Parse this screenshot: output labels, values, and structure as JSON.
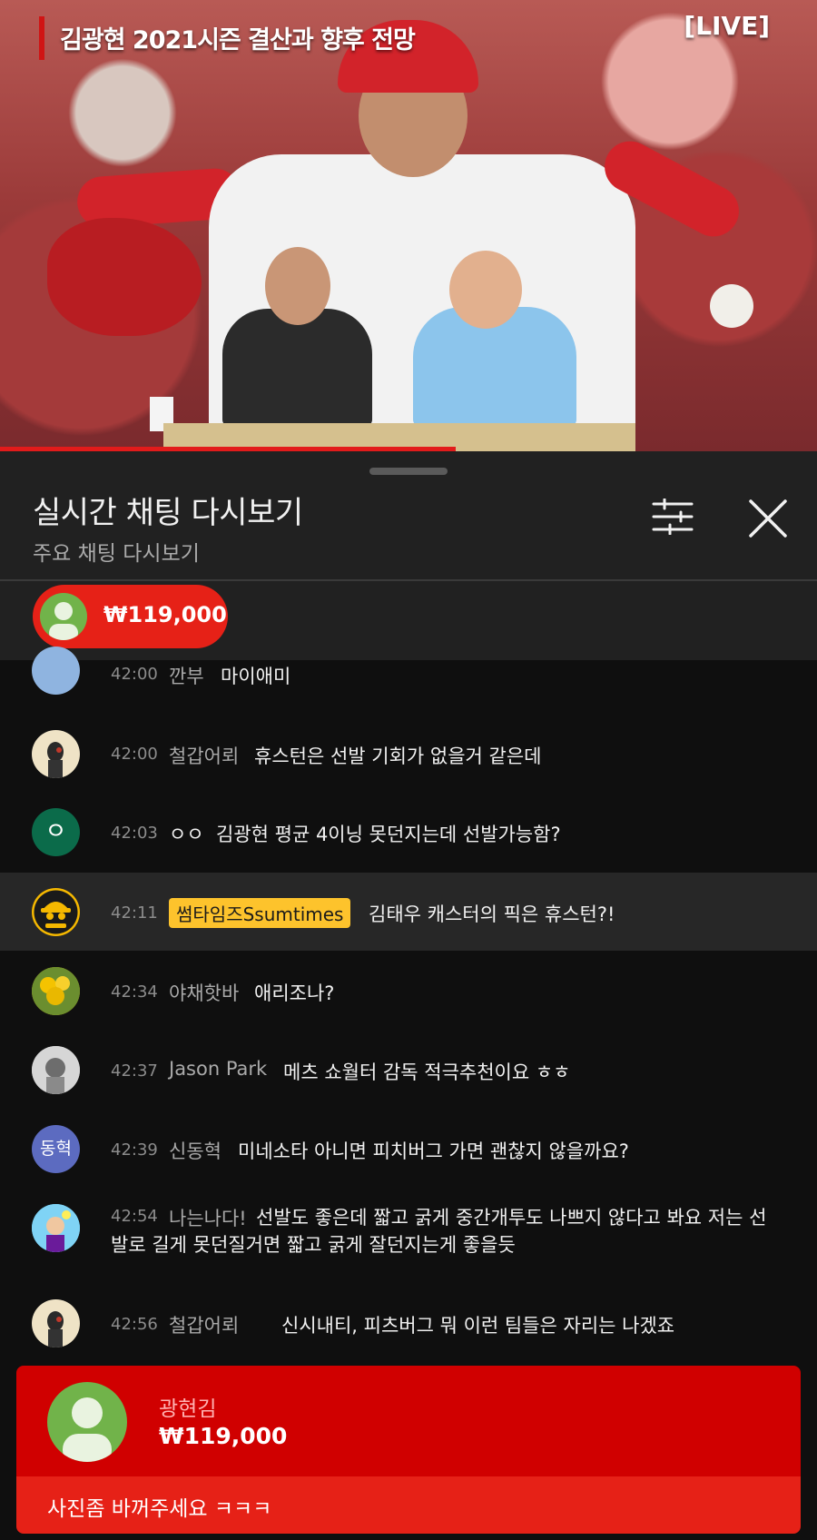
{
  "video": {
    "title": "김광현 2021시즌 결산과 향후 전망",
    "live_label": "[LIVE]"
  },
  "chat_panel": {
    "title": "실시간 채팅 다시보기",
    "subtitle": "주요 채팅 다시보기",
    "icons": [
      "filter-settings-icon",
      "close-icon"
    ],
    "ticker_amount": "₩119,000"
  },
  "messages": [
    {
      "time": "42:00",
      "author": "깐부",
      "text": "마이애미",
      "avatar_color": "#8fb4e0"
    },
    {
      "time": "42:00",
      "author": "철갑어뢰",
      "text": "휴스턴은 선발 기회가 없을거 같은데",
      "avatar_color": "#efe3c6"
    },
    {
      "time": "42:03",
      "author": "ㅇㅇ",
      "text": "김광현 평균 4이닝 못던지는데 선발가능함?",
      "avatar_color": "#0b6b4a",
      "avatar_letter": "ㅇ"
    },
    {
      "time": "42:11",
      "author": "썸타임즈Ssumtimes",
      "text": "김태우 캐스터의 픽은 휴스턴?!",
      "avatar_color": "#f5b800",
      "is_owner": true
    },
    {
      "time": "42:34",
      "author": "야채핫바",
      "text": "애리조나?",
      "avatar_color": "#d9b100"
    },
    {
      "time": "42:37",
      "author": "Jason Park",
      "text": "메츠 쇼월터 감독 적극추천이요 ㅎㅎ",
      "avatar_color": "#bdbdbd"
    },
    {
      "time": "42:39",
      "author": "신동혁",
      "text": "미네소타 아니면 피치버그 가면 괜찮지 않을까요?",
      "avatar_color": "#5c6bc0",
      "avatar_letter": "동혁"
    },
    {
      "time": "42:54",
      "author": "나는나다!",
      "text": "선발도 좋은데 짧고 굵게 중간개투도 나쁘지 않다고 봐요 저는 선발로 길게 못던질거면 짧고 굵게 잘던지는게 좋을듯",
      "avatar_color": "#4fc3f7"
    },
    {
      "time": "42:56",
      "author": "철갑어뢰",
      "text": "신시내티, 피츠버그 뭐 이런 팀들은 자리는 나겠죠",
      "avatar_color": "#efe3c6"
    }
  ],
  "super_chat": {
    "author": "광현김",
    "amount": "₩119,000",
    "message": "사진좀 바꺼주세요 ㅋㅋㅋ"
  },
  "colors": {
    "superchat_red": "#e62117",
    "superchat_dark_red": "#d00000",
    "owner_badge": "#fdc32c",
    "panel_bg": "#0f0f0f",
    "header_bg": "#212121"
  }
}
